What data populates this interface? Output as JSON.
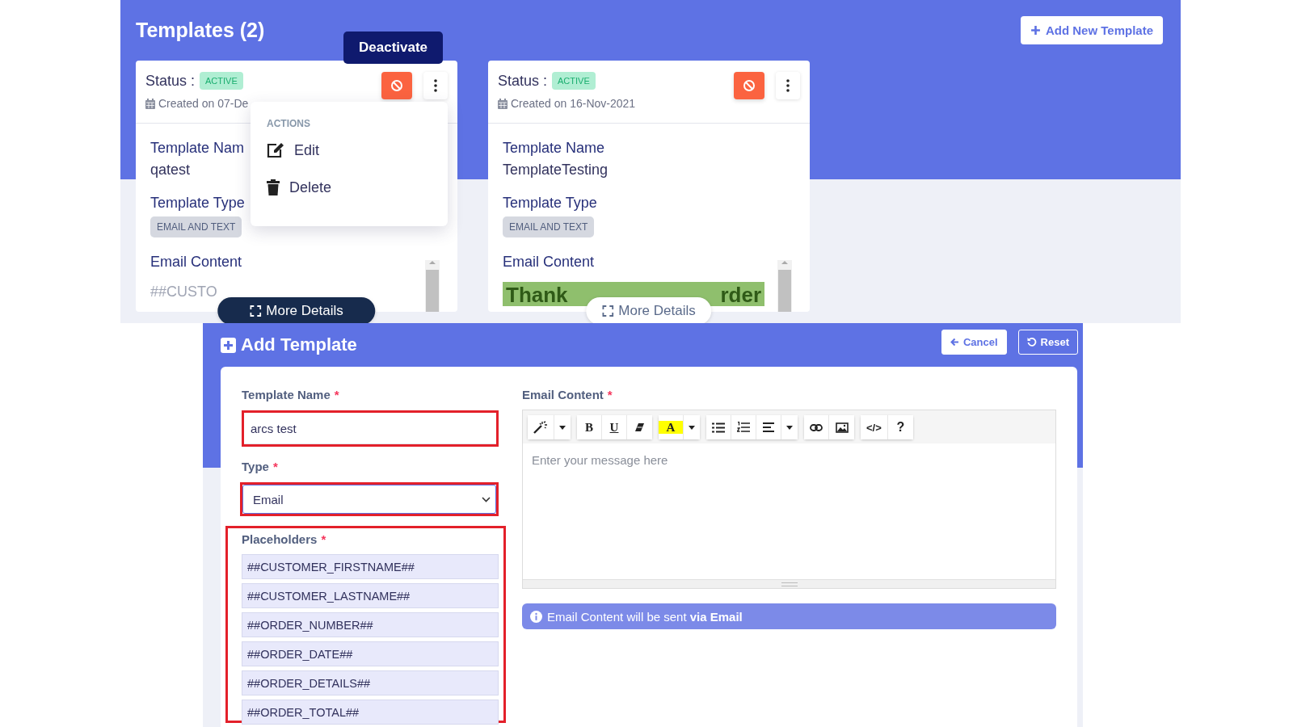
{
  "templates_page": {
    "title": "Templates (2)",
    "add_button": "Add New Template",
    "tooltip": "Deactivate",
    "cards": [
      {
        "status_label": "Status :",
        "status": "ACTIVE",
        "created": "Created on 07-De",
        "name_label": "Template Nam",
        "name": "qatest",
        "type_label": "Template Type",
        "type": "EMAIL AND TEXT",
        "content_label": "Email Content",
        "content_text": "##CUSTO",
        "more_button": "More Details",
        "more_highlighted": true,
        "tooltip_shown": true,
        "menu_open": true
      },
      {
        "status_label": "Status :",
        "status": "ACTIVE",
        "created": "Created on 16-Nov-2021",
        "name_label": "Template Name",
        "name": "TemplateTesting",
        "type_label": "Template Type",
        "type": "EMAIL AND TEXT",
        "content_label": "Email Content",
        "content_banner": [
          "Thank",
          "rder"
        ],
        "more_button": "More Details",
        "more_highlighted": false,
        "tooltip_shown": false,
        "menu_open": false
      }
    ],
    "menu": {
      "heading": "ACTIONS",
      "items": [
        {
          "label": "Edit",
          "kind": "edit"
        },
        {
          "label": "Delete",
          "kind": "delete"
        }
      ]
    }
  },
  "add_template": {
    "title": "Add Template",
    "cancel_button": "Cancel",
    "reset_button": "Reset",
    "required_mark": "*",
    "name_label": "Template Name",
    "name_value": "arcs test",
    "type_label": "Type",
    "type_value": "Email",
    "placeholders_label": "Placeholders",
    "placeholders": [
      "##CUSTOMER_FIRSTNAME##",
      "##CUSTOMER_LASTNAME##",
      "##ORDER_NUMBER##",
      "##ORDER_DATE##",
      "##ORDER_DETAILS##",
      "##ORDER_TOTAL##"
    ],
    "content_label": "Email Content",
    "content_placeholder": "Enter your message here",
    "toolbar": [
      [
        {
          "kind": "magic"
        },
        {
          "kind": "caret"
        }
      ],
      [
        {
          "kind": "bold",
          "label": "B"
        },
        {
          "kind": "underline",
          "label": "U"
        },
        {
          "kind": "eraser"
        }
      ],
      [
        {
          "kind": "highlight",
          "label": "A"
        },
        {
          "kind": "caret"
        }
      ],
      [
        {
          "kind": "ul"
        },
        {
          "kind": "ol"
        },
        {
          "kind": "align"
        },
        {
          "kind": "caret"
        }
      ],
      [
        {
          "kind": "link"
        },
        {
          "kind": "image"
        }
      ],
      [
        {
          "kind": "code",
          "label": "</>"
        },
        {
          "kind": "help",
          "label": "?"
        }
      ]
    ],
    "info": "Email Content will be sent **via Email**"
  }
}
